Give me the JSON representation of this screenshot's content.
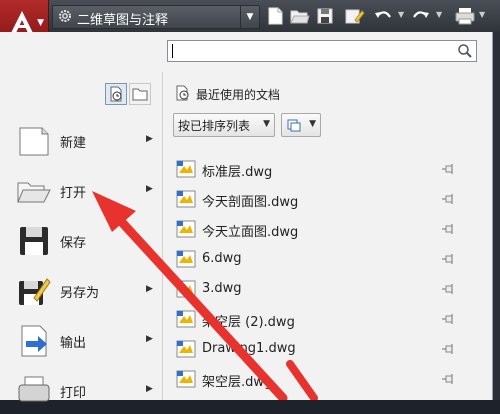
{
  "app": {
    "title_icon": "autocad-a-logo"
  },
  "workspace": {
    "label": "二维草图与注释"
  },
  "qat": {
    "icons": [
      "new-icon",
      "open-icon",
      "save-icon",
      "save-as-icon",
      "undo-icon",
      "redo-icon",
      "plot-icon"
    ]
  },
  "search": {
    "placeholder": ""
  },
  "menu": {
    "items": [
      {
        "label": "新建",
        "icon": "new-document-icon",
        "has_arrow": true
      },
      {
        "label": "打开",
        "icon": "open-folder-icon",
        "has_arrow": true
      },
      {
        "label": "保存",
        "icon": "floppy-disk-icon",
        "has_arrow": false
      },
      {
        "label": "另存为",
        "icon": "save-as-icon",
        "has_arrow": true
      },
      {
        "label": "输出",
        "icon": "export-icon",
        "has_arrow": true
      },
      {
        "label": "打印",
        "icon": "printer-icon",
        "has_arrow": true
      }
    ]
  },
  "recent": {
    "title": "最近使用的文档",
    "sort_label": "按已排序列表",
    "files": [
      "标准层.dwg",
      "今天剖面图.dwg",
      "今天立面图.dwg",
      "6.dwg",
      "3.dwg",
      "架空层 (2).dwg",
      "Drawing1.dwg",
      "架空层.dwg"
    ]
  },
  "colors": {
    "accent_red": "#e8322e",
    "app_button": "#b12b2b",
    "menu_bg": "#f2f2f2"
  }
}
